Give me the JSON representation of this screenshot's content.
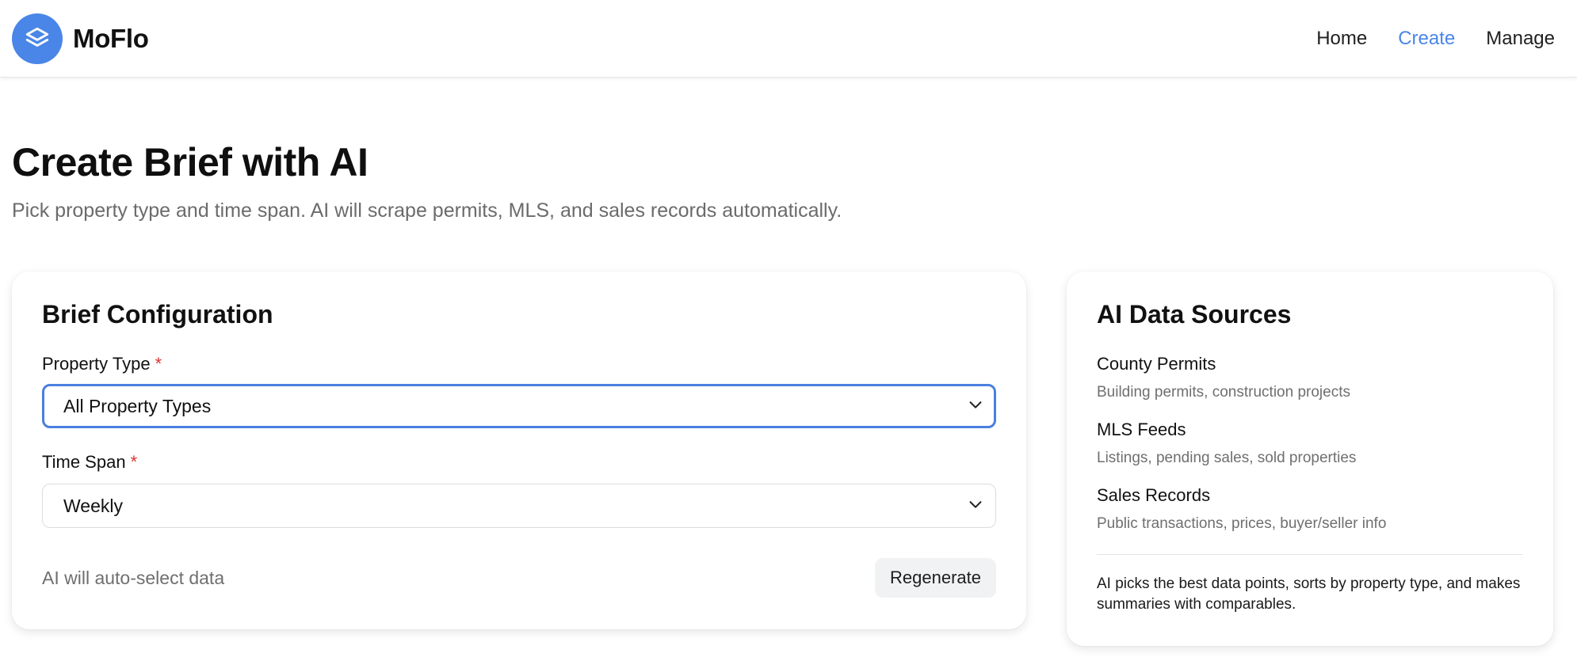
{
  "header": {
    "brand": "MoFlo",
    "nav": [
      {
        "label": "Home",
        "active": false
      },
      {
        "label": "Create",
        "active": true
      },
      {
        "label": "Manage",
        "active": false
      }
    ],
    "logo_icon": "layers-icon"
  },
  "page": {
    "title": "Create Brief with AI",
    "subtitle": "Pick property type and time span. AI will scrape permits, MLS, and sales records automatically."
  },
  "config": {
    "title": "Brief Configuration",
    "property_type": {
      "label": "Property Type",
      "required_mark": "*",
      "value": "All Property Types"
    },
    "time_span": {
      "label": "Time Span",
      "required_mark": "*",
      "value": "Weekly"
    },
    "footer_note": "AI will auto-select data",
    "regenerate_label": "Regenerate"
  },
  "sources": {
    "title": "AI Data Sources",
    "items": [
      {
        "name": "County Permits",
        "desc": "Building permits, construction projects"
      },
      {
        "name": "MLS Feeds",
        "desc": "Listings, pending sales, sold properties"
      },
      {
        "name": "Sales Records",
        "desc": "Public transactions, prices, buyer/seller info"
      }
    ],
    "note": "AI picks the best data points, sorts by property type, and makes summaries with comparables."
  },
  "colors": {
    "accent": "#4a86e8",
    "required": "#e03131",
    "focus_border": "#4a7fe0"
  }
}
